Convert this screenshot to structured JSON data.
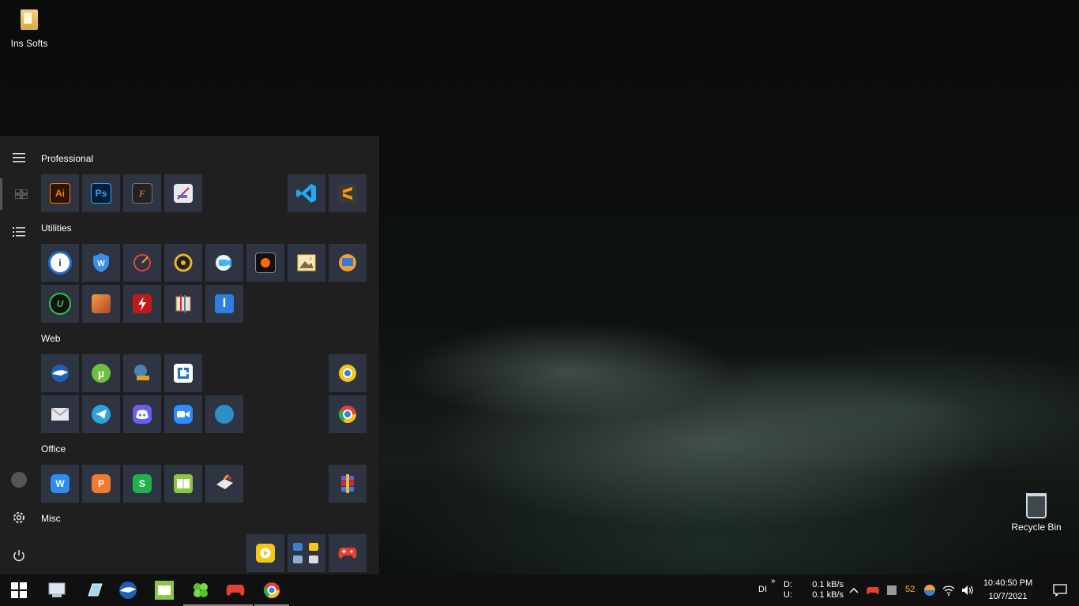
{
  "desktop": {
    "icons": [
      {
        "label": "Ins Softs",
        "icon": "folder-icon"
      },
      {
        "label": "Recycle Bin",
        "icon": "recycle-bin-icon"
      }
    ]
  },
  "start_menu": {
    "rail": [
      "hamburger-menu-icon",
      "tiles-view-icon",
      "list-view-icon",
      "user-avatar-icon",
      "settings-gear-icon",
      "power-icon"
    ],
    "groups": {
      "professional": {
        "label": "Professional",
        "tiles": [
          {
            "name": "illustrator",
            "text": "Ai",
            "color": "#ff7c00"
          },
          {
            "name": "photoshop",
            "text": "Ps",
            "color": "#31a8ff"
          },
          {
            "name": "fontlab",
            "text": "F",
            "color": "#d46a3a"
          },
          {
            "name": "paint-tool",
            "text": "",
            "color": "#5a6cd8"
          },
          {
            "name": "vscode",
            "text": "",
            "color": "#23a9f2"
          },
          {
            "name": "sublime-text",
            "text": "",
            "color": "#ff9800"
          }
        ]
      },
      "utilities": {
        "label": "Utilities",
        "tiles": [
          {
            "name": "one-password",
            "text": "i",
            "color": "#1a6fd3"
          },
          {
            "name": "wise-shield",
            "text": "W",
            "color": "#3b8fe8"
          },
          {
            "name": "speedometer",
            "text": "",
            "color": "#e0443a"
          },
          {
            "name": "disc-burner",
            "text": "",
            "color": "#e8b624"
          },
          {
            "name": "video-call",
            "text": "",
            "color": "#3fb4f0"
          },
          {
            "name": "recorder",
            "text": "",
            "color": "#ff6a00"
          },
          {
            "name": "image-viewer",
            "text": "",
            "color": "#f2c33c"
          },
          {
            "name": "screen-capture",
            "text": "",
            "color": "#3a7ad6"
          },
          {
            "name": "iobit-uninstaller",
            "text": "U",
            "color": "#28c840"
          },
          {
            "name": "boxed-app",
            "text": "",
            "color": "#d9822b"
          },
          {
            "name": "flash-tool",
            "text": "",
            "color": "#d62a2a"
          },
          {
            "name": "archive-tool",
            "text": "",
            "color": "#e07a3a"
          },
          {
            "name": "text-editor",
            "text": "I",
            "color": "#2f7ee0"
          }
        ]
      },
      "web": {
        "label": "Web",
        "tiles": [
          {
            "name": "thunderbird",
            "text": "",
            "color": "#3a7fd8"
          },
          {
            "name": "utorrent",
            "text": "",
            "color": "#6cc13f"
          },
          {
            "name": "downloader",
            "text": "",
            "color": "#4d7fb8"
          },
          {
            "name": "lightshot",
            "text": "",
            "color": "#1f74c8"
          },
          {
            "name": "chrome-canary",
            "text": "",
            "color": "#f5c518"
          },
          {
            "name": "mail",
            "text": "",
            "color": "#e8e8e8"
          },
          {
            "name": "telegram",
            "text": "",
            "color": "#2aa3df"
          },
          {
            "name": "discord",
            "text": "",
            "color": "#6c5cf0"
          },
          {
            "name": "zoom",
            "text": "",
            "color": "#2d8cff"
          },
          {
            "name": "evernote-like",
            "text": "",
            "color": "#2e8fc8"
          },
          {
            "name": "chrome",
            "text": "",
            "color": "#e34133"
          }
        ]
      },
      "office": {
        "label": "Office",
        "tiles": [
          {
            "name": "wps-writer",
            "text": "W",
            "color": "#2e8cf0"
          },
          {
            "name": "wps-presentation",
            "text": "P",
            "color": "#f07a2e"
          },
          {
            "name": "wps-spreadsheets",
            "text": "S",
            "color": "#21b24b"
          },
          {
            "name": "ebook-reader",
            "text": "",
            "color": "#8cc63f"
          },
          {
            "name": "cleaner",
            "text": "",
            "color": "#e0a020"
          },
          {
            "name": "winrar",
            "text": "",
            "color": "#8a4fb0"
          }
        ]
      },
      "misc": {
        "label": "Misc",
        "tiles": [
          {
            "name": "media-player",
            "text": "",
            "color": "#f5c518"
          },
          {
            "name": "folder-group",
            "text": "",
            "color": "#3a7fd8"
          },
          {
            "name": "game-controller",
            "text": "",
            "color": "#e34133"
          }
        ]
      }
    }
  },
  "taskbar": {
    "pinned": [
      "windows-start-icon",
      "control-panel-icon",
      "notes-icon",
      "thunderbird-icon",
      "ebook-reader-icon",
      "clover-icon",
      "game-controller-icon",
      "chrome-icon"
    ],
    "tray": {
      "lang": "DI",
      "disk_labels": [
        "D:",
        "U:"
      ],
      "net_speeds": [
        "0.1 kB/s",
        "0.1 kB/s"
      ],
      "temp": "52",
      "time": "10:40:50 PM",
      "date": "10/7/2021"
    }
  },
  "colors": {
    "tile_bg": "#2f3442",
    "start_bg": "#1f1f1f",
    "taskbar_bg": "#101010"
  }
}
